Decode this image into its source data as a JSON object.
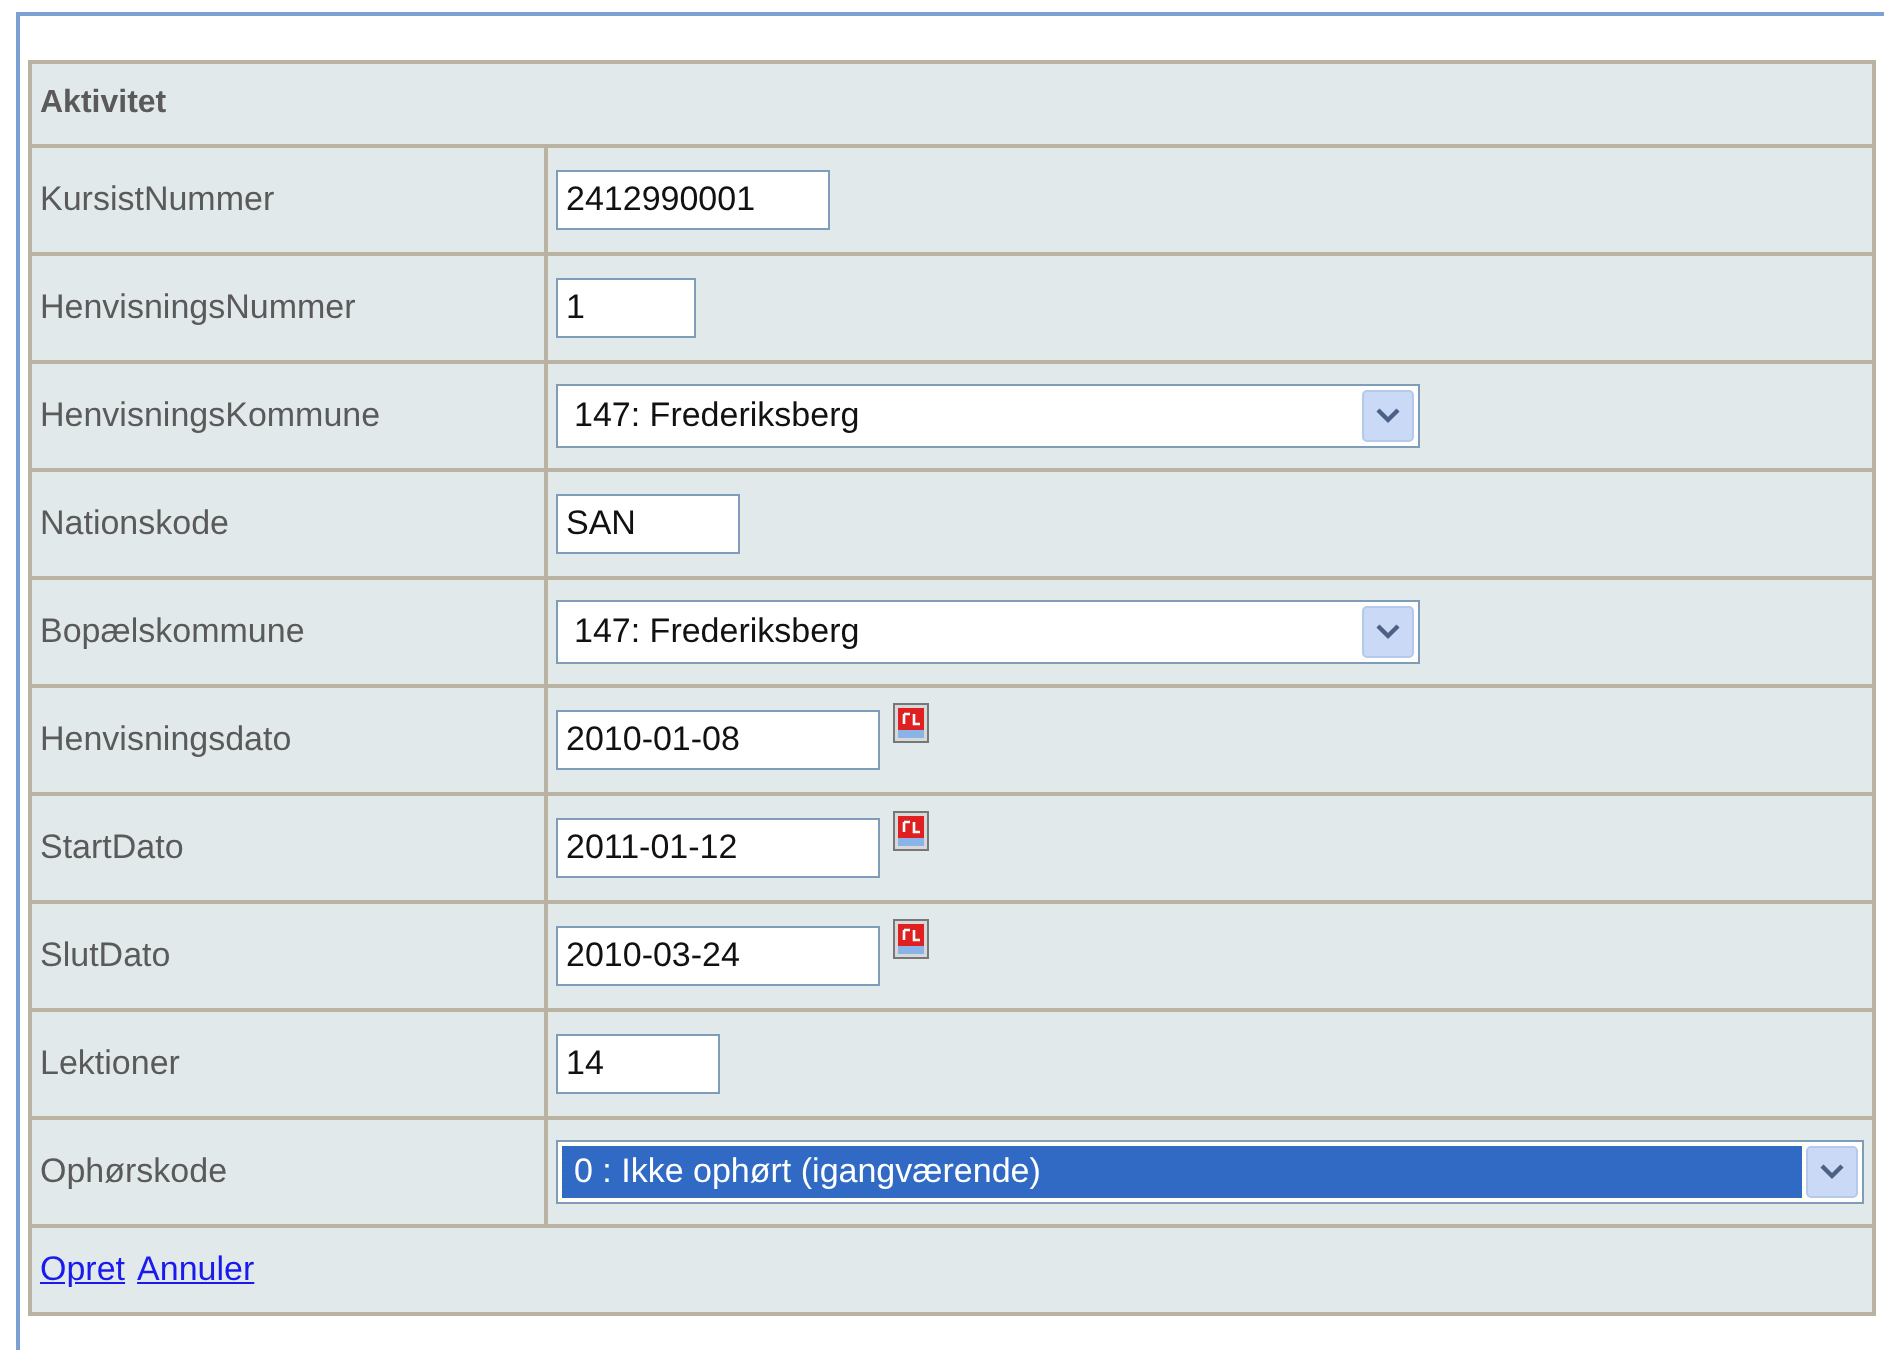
{
  "form": {
    "title": "Aktivitet",
    "fields": [
      {
        "label": "KursistNummer",
        "kind": "text",
        "value": "2412990001",
        "focused": false
      },
      {
        "label": "HenvisningsNummer",
        "kind": "text",
        "value": "1",
        "focused": false
      },
      {
        "label": "HenvisningsKommune",
        "kind": "select",
        "value": "147: Frederiksberg",
        "focused": false
      },
      {
        "label": "Nationskode",
        "kind": "text",
        "value": "SAN",
        "focused": false
      },
      {
        "label": "Bopælskommune",
        "kind": "select",
        "value": "147: Frederiksberg",
        "focused": false
      },
      {
        "label": "Henvisningsdato",
        "kind": "date",
        "value": "2010-01-08",
        "focused": false
      },
      {
        "label": "StartDato",
        "kind": "date",
        "value": "2011-01-12",
        "focused": false
      },
      {
        "label": "SlutDato",
        "kind": "date",
        "value": "2010-03-24",
        "focused": false
      },
      {
        "label": "Lektioner",
        "kind": "text",
        "value": "14",
        "focused": false
      },
      {
        "label": "Ophørskode",
        "kind": "select",
        "value": "0 : Ikke ophørt (igangværende)",
        "focused": true
      }
    ],
    "links": [
      "Opret",
      "Annuler"
    ]
  }
}
